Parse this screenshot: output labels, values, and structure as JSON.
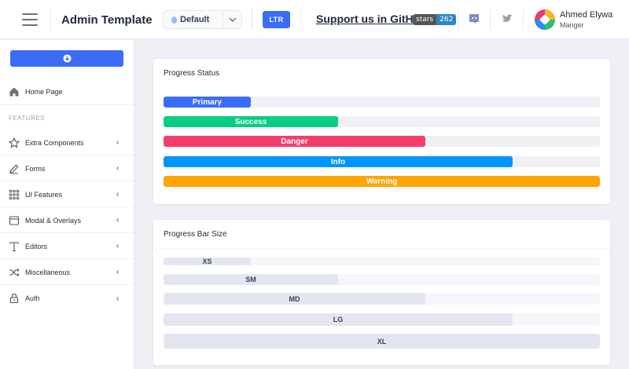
{
  "header": {
    "title": "Admin Template",
    "theme_select": {
      "value": "Default"
    },
    "direction_button": "LTR",
    "github_link": "Support us in GitHub",
    "stars_badge": {
      "label": "stars",
      "count": "262"
    },
    "icons": [
      "menu-icon",
      "discord-icon",
      "twitter-icon"
    ],
    "user": {
      "name": "Ahmed Elywa",
      "role": "Manger"
    }
  },
  "sidebar": {
    "top_button_icon": "download-icon",
    "home": {
      "label": "Home Page",
      "icon": "home-icon"
    },
    "section_label": "FEATURES",
    "items": [
      {
        "label": "Extra Components",
        "icon": "star-icon"
      },
      {
        "label": "Forms",
        "icon": "edit-icon"
      },
      {
        "label": "UI Features",
        "icon": "grid-icon"
      },
      {
        "label": "Modal & Overlays",
        "icon": "browser-icon"
      },
      {
        "label": "Editors",
        "icon": "text-icon"
      },
      {
        "label": "Miscellaneous",
        "icon": "shuffle-icon"
      },
      {
        "label": "Auth",
        "icon": "lock-icon"
      }
    ]
  },
  "progress_status": {
    "title": "Progress Status",
    "bars": [
      {
        "label": "Primary",
        "value": 20,
        "color": "#3b6cf6"
      },
      {
        "label": "Success",
        "value": 40,
        "color": "#05cd84"
      },
      {
        "label": "Danger",
        "value": 60,
        "color": "#f53d6b"
      },
      {
        "label": "Info",
        "value": 80,
        "color": "#0095ff"
      },
      {
        "label": "Warning",
        "value": 100,
        "color": "#ffa400"
      }
    ]
  },
  "progress_size": {
    "title": "Progress Bar Size",
    "bars": [
      {
        "label": "XS",
        "value": 20
      },
      {
        "label": "SM",
        "value": 40
      },
      {
        "label": "MD",
        "value": 60
      },
      {
        "label": "LG",
        "value": 80
      },
      {
        "label": "XL",
        "value": 100
      }
    ]
  },
  "colors": {
    "accent": "#3b6cf6",
    "page_bg": "#eef0f4"
  }
}
